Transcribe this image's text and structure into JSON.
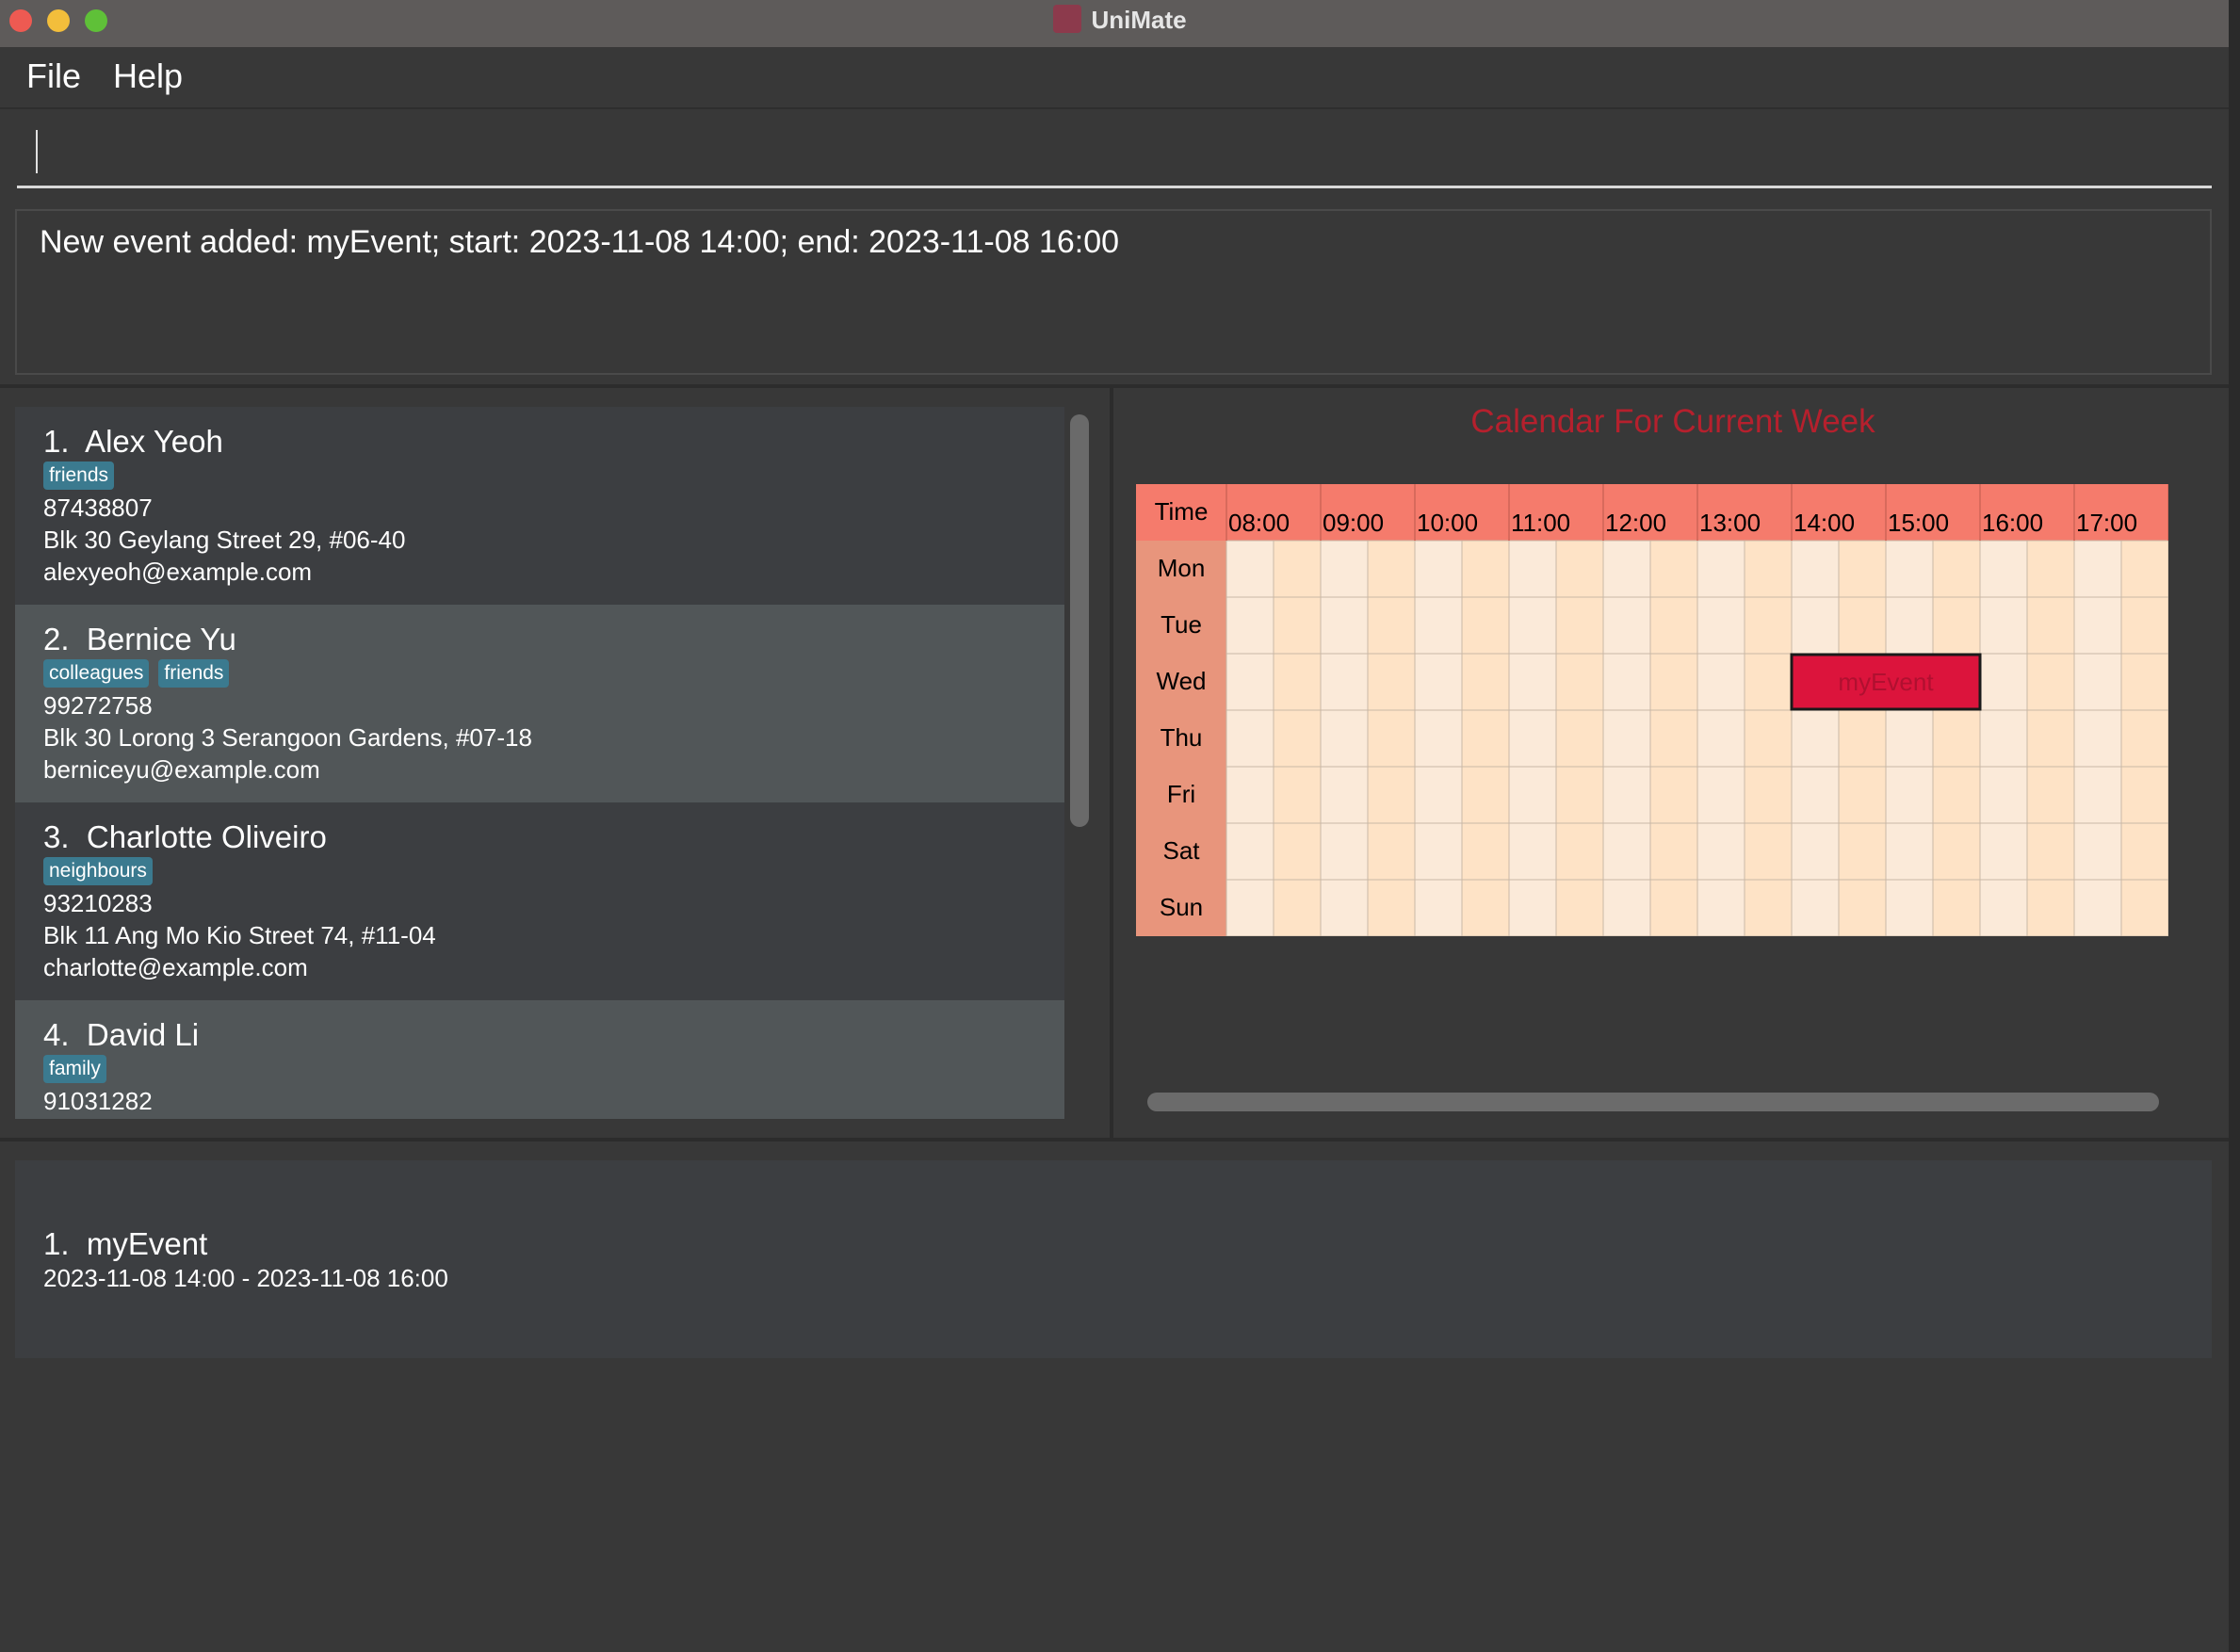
{
  "window": {
    "title": "UniMate",
    "controls": {
      "close_color": "#ee5a52",
      "minimize_color": "#f3be3b",
      "maximize_color": "#5fc038"
    }
  },
  "menu": {
    "items": [
      "File",
      "Help"
    ]
  },
  "command_box": {
    "value": "",
    "placeholder": ""
  },
  "result_display": {
    "message": "New event added: myEvent; start: 2023-11-08 14:00; end: 2023-11-08 16:00"
  },
  "persons": [
    {
      "index": "1.",
      "name": "Alex Yeoh",
      "tags": [
        "friends"
      ],
      "phone": "87438807",
      "address": "Blk 30 Geylang Street 29, #06-40",
      "email": "alexyeoh@example.com"
    },
    {
      "index": "2.",
      "name": "Bernice Yu",
      "tags": [
        "colleagues",
        "friends"
      ],
      "phone": "99272758",
      "address": "Blk 30 Lorong 3 Serangoon Gardens, #07-18",
      "email": "berniceyu@example.com"
    },
    {
      "index": "3.",
      "name": "Charlotte Oliveiro",
      "tags": [
        "neighbours"
      ],
      "phone": "93210283",
      "address": "Blk 11 Ang Mo Kio Street 74, #11-04",
      "email": "charlotte@example.com"
    },
    {
      "index": "4.",
      "name": "David Li",
      "tags": [
        "family"
      ],
      "phone": "91031282",
      "address": "",
      "email": ""
    }
  ],
  "calendar": {
    "title": "Calendar For Current Week",
    "corner_label": "Time",
    "times": [
      "08:00",
      "09:00",
      "10:00",
      "11:00",
      "12:00",
      "13:00",
      "14:00",
      "15:00",
      "16:00",
      "17:00"
    ],
    "days": [
      "Mon",
      "Tue",
      "Wed",
      "Thu",
      "Fri",
      "Sat",
      "Sun"
    ],
    "event": {
      "name": "myEvent",
      "day": "Wed",
      "start": "14:00",
      "end": "16:00"
    },
    "colors": {
      "header": "#f57b6c",
      "day_column": "#e8957c",
      "cell_light": "#fbead9",
      "cell_dark": "#fee3c6",
      "event": "#dc143c"
    }
  },
  "events": [
    {
      "index": "1.",
      "name": "myEvent",
      "time": "2023-11-08 14:00 - 2023-11-08 16:00"
    }
  ]
}
